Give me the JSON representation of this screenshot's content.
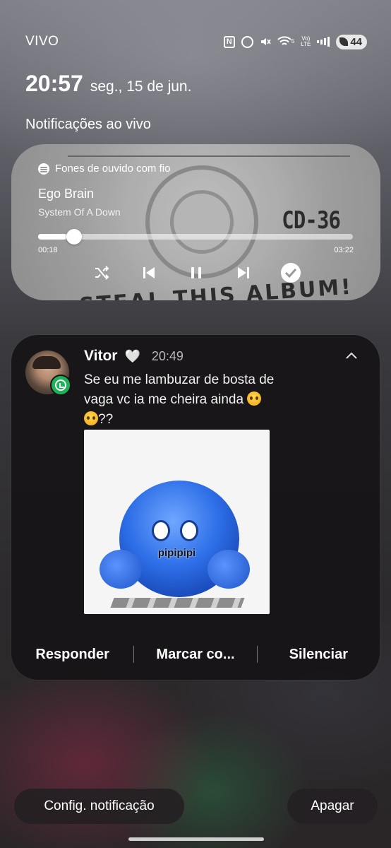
{
  "status_bar": {
    "carrier": "VIVO",
    "network_label_top": "5",
    "volte_label_top": "Vo)",
    "volte_label_bottom": "LTE",
    "battery": "44",
    "icons": [
      "nfc-icon",
      "alarm-icon",
      "mute-icon",
      "wifi-icon",
      "volte-icon",
      "signal-icon",
      "battery-icon"
    ]
  },
  "lockscreen": {
    "time": "20:57",
    "date": "seg., 15 de jun.",
    "live_notifications_label": "Notificações ao vivo"
  },
  "media": {
    "source": "Fones de ouvido com fio",
    "title": "Ego Brain",
    "artist": "System Of A Down",
    "elapsed": "00:18",
    "total": "03:22",
    "progress_fraction": 0.09,
    "album_text_1": "CD-36",
    "album_text_2": "STEAL THIS ALBUM!",
    "controls": [
      "shuffle-icon",
      "previous-icon",
      "pause-icon",
      "next-icon",
      "check-icon"
    ]
  },
  "message": {
    "app": "WhatsApp",
    "sender": "Vitor",
    "heart": "🤍",
    "time": "20:49",
    "text_line_1": "Se eu me lambuzar de bosta de",
    "text_line_2": "vaga vc ia me cheira ainda",
    "text_line_3": "??",
    "sticker_text": "pipipipi",
    "actions": {
      "reply": "Responder",
      "mark": "Marcar co...",
      "mute": "Silenciar"
    }
  },
  "bottom": {
    "settings_label": "Config. notificação",
    "clear_label": "Apagar"
  },
  "colors": {
    "whatsapp_green": "#1fb157",
    "card_bg": "#161416"
  }
}
